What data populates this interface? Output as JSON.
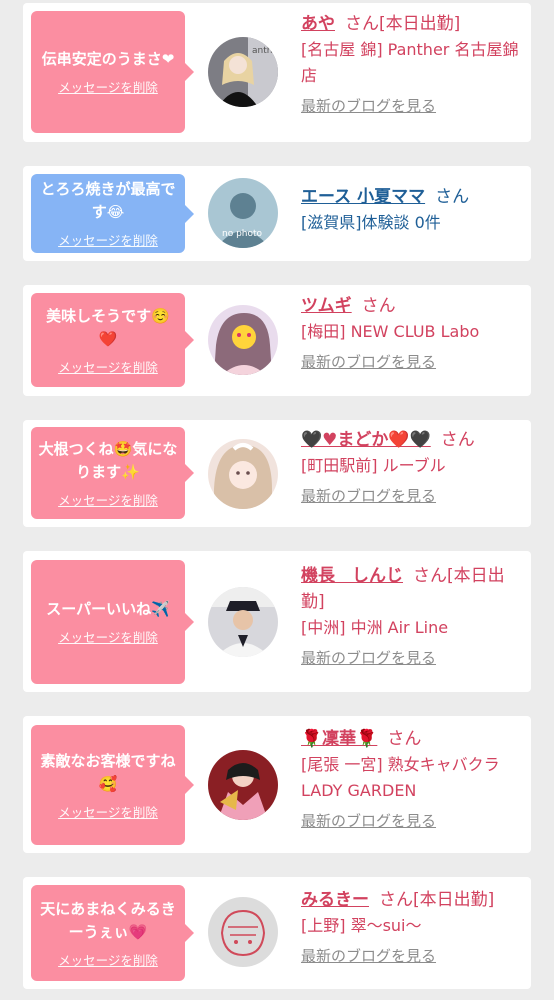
{
  "colors": {
    "pink": "#fb8ea1",
    "blue": "#86b4f5",
    "name_pink": "#d2425f",
    "name_blue": "#1f5f97",
    "link_gray": "#8c8c8c"
  },
  "delete_label": "メッセージを削除",
  "blog_label": "最新のブログを見る",
  "san_label": "さん",
  "messages": [
    {
      "text": "伝串安定のうまさ❤",
      "name": "あや",
      "status": "[本日出勤]",
      "shop": "[名古屋 錦] Panther 名古屋錦店",
      "avatar": "avatar-panther"
    },
    {
      "text": "とろろ焼きが最高です😂",
      "name": "エース 小夏ママ",
      "status": "",
      "shop": "[滋賀県]体験談 0件",
      "avatar": "no-photo-icon"
    },
    {
      "text": "美味しそうです☺️❤️",
      "name": "ツムギ",
      "status": "",
      "shop": "[梅田] NEW CLUB Labo",
      "avatar": "avatar-tsumugi"
    },
    {
      "text": "大根つくね🤩気になります✨",
      "name": "🖤♥まどか❤️🖤",
      "status": "",
      "shop": "[町田駅前] ルーブル",
      "avatar": "avatar-madoka"
    },
    {
      "text": "スーパーいいね✈️",
      "name": "機長　しんじ",
      "status": "[本日出勤]",
      "shop": "[中洲] 中洲 Air Line",
      "avatar": "avatar-pilot"
    },
    {
      "text": "素敵なお客様ですね🥰",
      "name": "🌹凜華🌹",
      "status": "",
      "shop": "[尾張 一宮] 熟女キャバクラ LADY GARDEN",
      "avatar": "avatar-rinka"
    },
    {
      "text": "天にあまねくみるきーうぇぃ💗",
      "name": "みるきー",
      "status": "[本日出勤]",
      "shop": "[上野] 翠〜sui〜",
      "avatar": "avatar-milky"
    }
  ]
}
